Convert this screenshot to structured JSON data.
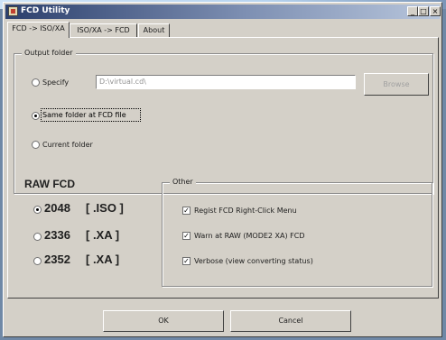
{
  "window": {
    "title": "FCD Utility",
    "controls": [
      "_",
      "□",
      "×"
    ]
  },
  "tabs": [
    {
      "label": "FCD -> ISO/XA"
    },
    {
      "label": "ISO/XA -> FCD"
    },
    {
      "label": "About"
    }
  ],
  "output_folder": {
    "legend": "Output folder",
    "specify_label": "Specify",
    "path_value": "D:\\virtual.cd\\",
    "browse_label": "Browse",
    "same_folder_label": "Same folder at FCD file",
    "current_folder_label": "Current folder",
    "selected": "same_folder"
  },
  "raw_fcd": {
    "title": "RAW FCD",
    "options": [
      {
        "size": "2048",
        "fmt": "[ .ISO ]",
        "checked": true
      },
      {
        "size": "2336",
        "fmt": "[ .XA ]",
        "checked": false
      },
      {
        "size": "2352",
        "fmt": "[ .XA ]",
        "checked": false
      }
    ]
  },
  "other": {
    "legend": "Other",
    "options": [
      {
        "label": "Regist FCD Right-Click Menu",
        "checked": true
      },
      {
        "label": "Warn at RAW (MODE2 XA) FCD",
        "checked": true
      },
      {
        "label": "Verbose (view converting status)",
        "checked": true
      }
    ]
  },
  "footer": {
    "ok_label": "OK",
    "cancel_label": "Cancel"
  }
}
